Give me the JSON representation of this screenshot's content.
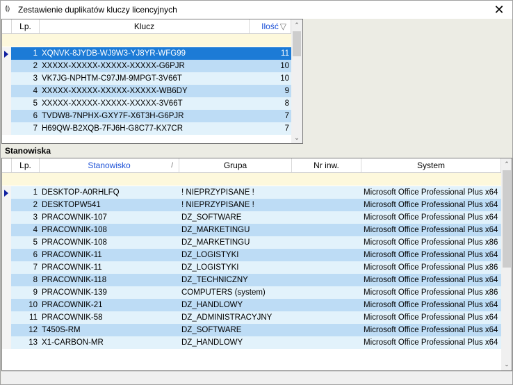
{
  "window": {
    "title": "Zestawienie duplikatów kluczy licencyjnych",
    "close_glyph": "✕",
    "icon_glyph": "⟬⟭"
  },
  "keys_grid": {
    "columns": {
      "lp": "Lp.",
      "klucz": "Klucz",
      "ilosc": "Ilość"
    },
    "sort_glyph": "▽",
    "rows": [
      {
        "lp": "1",
        "klucz": "XQNVK-8JYDB-WJ9W3-YJ8YR-WFG99",
        "ilosc": "11"
      },
      {
        "lp": "2",
        "klucz": "XXXXX-XXXXX-XXXXX-XXXXX-G6PJR",
        "ilosc": "10"
      },
      {
        "lp": "3",
        "klucz": "VK7JG-NPHTM-C97JM-9MPGT-3V66T",
        "ilosc": "10"
      },
      {
        "lp": "4",
        "klucz": "XXXXX-XXXXX-XXXXX-XXXXX-WB6DY",
        "ilosc": "9"
      },
      {
        "lp": "5",
        "klucz": "XXXXX-XXXXX-XXXXX-XXXXX-3V66T",
        "ilosc": "8"
      },
      {
        "lp": "6",
        "klucz": "TVDW8-7NPHX-GXY7F-X6T3H-G6PJR",
        "ilosc": "7"
      },
      {
        "lp": "7",
        "klucz": "H69QW-B2XQB-7FJ6H-G8C77-KX7CR",
        "ilosc": "7"
      }
    ]
  },
  "section_title": "Stanowiska",
  "stations_grid": {
    "columns": {
      "lp": "Lp.",
      "stanowisko": "Stanowisko",
      "grupa": "Grupa",
      "nr_inw": "Nr inw.",
      "system": "System"
    },
    "sort_glyph": "/",
    "rows": [
      {
        "lp": "1",
        "stanowisko": "DESKTOP-A0RHLFQ",
        "grupa": "! NIEPRZYPISANE !",
        "nr_inw": "",
        "system": "Microsoft Office Professional Plus x64"
      },
      {
        "lp": "2",
        "stanowisko": "DESKTOPW541",
        "grupa": "! NIEPRZYPISANE !",
        "nr_inw": "",
        "system": "Microsoft Office Professional Plus x64"
      },
      {
        "lp": "3",
        "stanowisko": "PRACOWNIK-107",
        "grupa": "DZ_SOFTWARE",
        "nr_inw": "",
        "system": "Microsoft Office Professional Plus x64"
      },
      {
        "lp": "4",
        "stanowisko": "PRACOWNIK-108",
        "grupa": "DZ_MARKETINGU",
        "nr_inw": "",
        "system": "Microsoft Office Professional Plus x64"
      },
      {
        "lp": "5",
        "stanowisko": "PRACOWNIK-108",
        "grupa": "DZ_MARKETINGU",
        "nr_inw": "",
        "system": "Microsoft Office Professional Plus x86"
      },
      {
        "lp": "6",
        "stanowisko": "PRACOWNIK-11",
        "grupa": "DZ_LOGISTYKI",
        "nr_inw": "",
        "system": "Microsoft Office Professional Plus x64"
      },
      {
        "lp": "7",
        "stanowisko": "PRACOWNIK-11",
        "grupa": "DZ_LOGISTYKI",
        "nr_inw": "",
        "system": "Microsoft Office Professional Plus x86"
      },
      {
        "lp": "8",
        "stanowisko": "PRACOWNIK-118",
        "grupa": "DZ_TECHNICZNY",
        "nr_inw": "",
        "system": "Microsoft Office Professional Plus x64"
      },
      {
        "lp": "9",
        "stanowisko": "PRACOWNIK-139",
        "grupa": "COMPUTERS (system)",
        "nr_inw": "",
        "system": "Microsoft Office Professional Plus x86"
      },
      {
        "lp": "10",
        "stanowisko": "PRACOWNIK-21",
        "grupa": "DZ_HANDLOWY",
        "nr_inw": "",
        "system": "Microsoft Office Professional Plus x64"
      },
      {
        "lp": "11",
        "stanowisko": "PRACOWNIK-58",
        "grupa": "DZ_ADMINISTRACYJNY",
        "nr_inw": "",
        "system": "Microsoft Office Professional Plus x64"
      },
      {
        "lp": "12",
        "stanowisko": "T450S-RM",
        "grupa": "DZ_SOFTWARE",
        "nr_inw": "",
        "system": "Microsoft Office Professional Plus x64"
      },
      {
        "lp": "13",
        "stanowisko": "X1-CARBON-MR",
        "grupa": "DZ_HANDLOWY",
        "nr_inw": "",
        "system": "Microsoft Office Professional Plus x64"
      }
    ]
  },
  "scroll_arrows": {
    "up": "⌃",
    "down": "⌄"
  },
  "colors": {
    "selected": "#1c7bd6",
    "row_light": "#e2f2fb",
    "row_alt": "#bddcf5",
    "filter": "#fdf8dc",
    "sorted_header": "#1a4fd6"
  }
}
